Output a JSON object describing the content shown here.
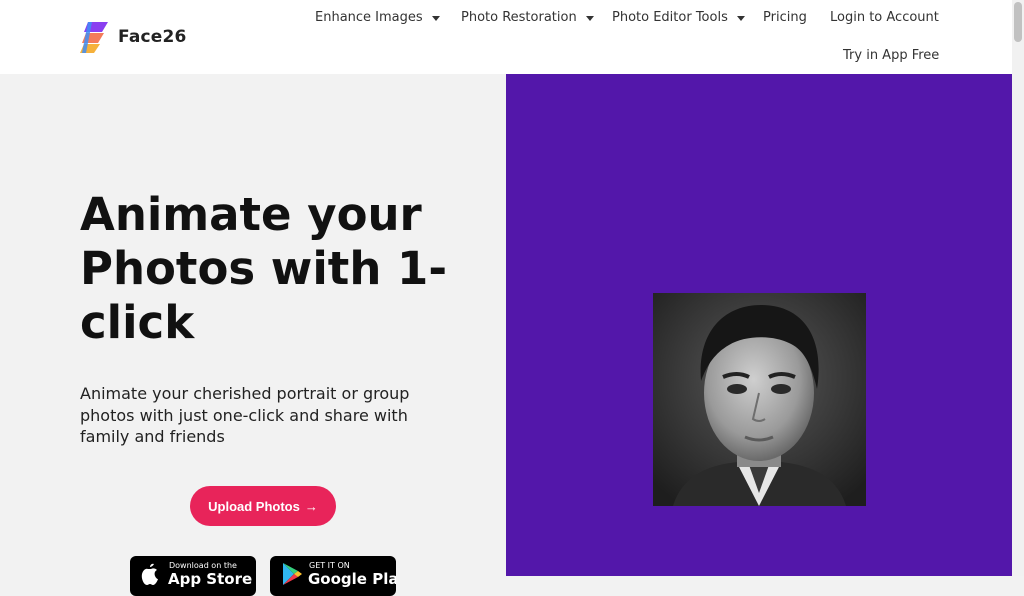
{
  "brand": {
    "name": "Face26",
    "colors": {
      "accent": "#e8245a",
      "panel": "#5317aa"
    }
  },
  "nav": {
    "items": [
      {
        "label": "Enhance Images",
        "dropdown": true
      },
      {
        "label": "Photo Restoration",
        "dropdown": true
      },
      {
        "label": "Photo Editor Tools",
        "dropdown": true
      },
      {
        "label": "Pricing",
        "dropdown": false
      },
      {
        "label": "Login to Account",
        "dropdown": false
      }
    ],
    "try_label": "Try in App Free"
  },
  "hero": {
    "title": "Animate your Photos with 1-click",
    "subtitle": "Animate your cherished portrait or group photos with just one-click and share with family and friends",
    "upload_label": "Upload Photos",
    "upload_icon": "arrow-right-icon"
  },
  "stores": {
    "apple": {
      "small": "Download on the",
      "big": "App Store",
      "icon": "apple-icon"
    },
    "google": {
      "small": "GET IT ON",
      "big": "Google Play",
      "icon": "google-play-icon"
    }
  }
}
